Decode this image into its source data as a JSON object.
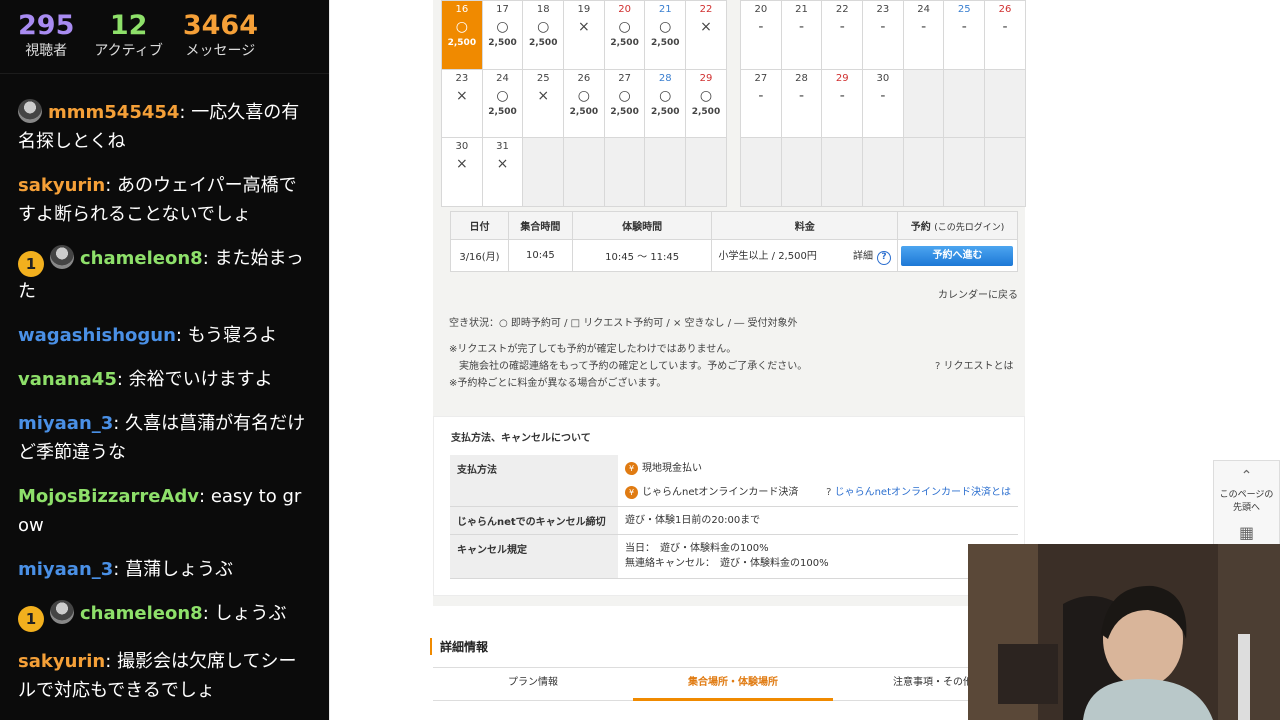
{
  "stats": [
    {
      "value": "295",
      "label": "視聴者",
      "color": "#a98cf2"
    },
    {
      "value": "12",
      "label": "アクティブ",
      "color": "#8ee06a"
    },
    {
      "value": "3464",
      "label": "メッセージ",
      "color": "#f5a038"
    }
  ],
  "chat": [
    {
      "badge": "",
      "avatar": true,
      "user": "mmm545454",
      "color": "#f5a038",
      "text": "一応久喜の有名探しとくね"
    },
    {
      "badge": "",
      "avatar": false,
      "user": "sakyurin",
      "color": "#f5a038",
      "text": "あのウェイパー高橋ですよ断られることないでしょ"
    },
    {
      "badge": "1",
      "avatar": true,
      "user": "chameleon8",
      "color": "#8ee06a",
      "text": "また始まった"
    },
    {
      "badge": "",
      "avatar": false,
      "user": "wagashishogun",
      "color": "#4a90e6",
      "text": "もう寝ろよ"
    },
    {
      "badge": "",
      "avatar": false,
      "user": "vanana45",
      "color": "#8ee06a",
      "text": "余裕でいけますよ"
    },
    {
      "badge": "",
      "avatar": false,
      "user": "miyaan_3",
      "color": "#4a90e6",
      "text": "久喜は菖蒲が有名だけど季節違うな"
    },
    {
      "badge": "",
      "avatar": false,
      "user": "MojosBizzarreAdv",
      "color": "#8ee06a",
      "text": "easy to grow"
    },
    {
      "badge": "",
      "avatar": false,
      "user": "miyaan_3",
      "color": "#4a90e6",
      "text": "菖蒲しょうぶ"
    },
    {
      "badge": "1",
      "avatar": true,
      "user": "chameleon8",
      "color": "#8ee06a",
      "text": "しょうぶ"
    },
    {
      "badge": "",
      "avatar": false,
      "user": "sakyurin",
      "color": "#f5a038",
      "text": "撮影会は欠席してシールで対応もできるでしょ"
    }
  ],
  "calendar_left": [
    [
      {
        "d": "16",
        "s": "○",
        "p": "2,500",
        "t": "selected"
      },
      {
        "d": "17",
        "s": "○",
        "p": "2,500"
      },
      {
        "d": "18",
        "s": "○",
        "p": "2,500"
      },
      {
        "d": "19",
        "s": "×",
        "p": ""
      },
      {
        "d": "20",
        "s": "○",
        "p": "2,500",
        "t": "sun"
      },
      {
        "d": "21",
        "s": "○",
        "p": "2,500",
        "t": "sat"
      },
      {
        "d": "22",
        "s": "×",
        "p": "",
        "t": "sun"
      }
    ],
    [
      {
        "d": "23",
        "s": "×",
        "p": ""
      },
      {
        "d": "24",
        "s": "○",
        "p": "2,500"
      },
      {
        "d": "25",
        "s": "×",
        "p": ""
      },
      {
        "d": "26",
        "s": "○",
        "p": "2,500"
      },
      {
        "d": "27",
        "s": "○",
        "p": "2,500"
      },
      {
        "d": "28",
        "s": "○",
        "p": "2,500",
        "t": "sat"
      },
      {
        "d": "29",
        "s": "○",
        "p": "2,500",
        "t": "sun"
      }
    ],
    [
      {
        "d": "30",
        "s": "×",
        "p": ""
      },
      {
        "d": "31",
        "s": "×",
        "p": ""
      },
      {
        "d": "",
        "s": "",
        "p": "",
        "t": "empty"
      },
      {
        "d": "",
        "s": "",
        "p": "",
        "t": "empty"
      },
      {
        "d": "",
        "s": "",
        "p": "",
        "t": "empty"
      },
      {
        "d": "",
        "s": "",
        "p": "",
        "t": "empty"
      },
      {
        "d": "",
        "s": "",
        "p": "",
        "t": "empty"
      }
    ]
  ],
  "calendar_right": [
    [
      {
        "d": "20",
        "s": "-"
      },
      {
        "d": "21",
        "s": "-"
      },
      {
        "d": "22",
        "s": "-"
      },
      {
        "d": "23",
        "s": "-"
      },
      {
        "d": "24",
        "s": "-"
      },
      {
        "d": "25",
        "s": "-",
        "t": "sat"
      },
      {
        "d": "26",
        "s": "-",
        "t": "sun"
      }
    ],
    [
      {
        "d": "27",
        "s": "-"
      },
      {
        "d": "28",
        "s": "-"
      },
      {
        "d": "29",
        "s": "-",
        "t": "sun"
      },
      {
        "d": "30",
        "s": "-"
      },
      {
        "d": "",
        "s": "",
        "t": "empty"
      },
      {
        "d": "",
        "s": "",
        "t": "empty"
      },
      {
        "d": "",
        "s": "",
        "t": "empty"
      }
    ],
    [
      {
        "d": "",
        "s": "",
        "t": "empty"
      },
      {
        "d": "",
        "s": "",
        "t": "empty"
      },
      {
        "d": "",
        "s": "",
        "t": "empty"
      },
      {
        "d": "",
        "s": "",
        "t": "empty"
      },
      {
        "d": "",
        "s": "",
        "t": "empty"
      },
      {
        "d": "",
        "s": "",
        "t": "empty"
      },
      {
        "d": "",
        "s": "",
        "t": "empty"
      }
    ]
  ],
  "plan_table": {
    "headers": [
      "日付",
      "集合時間",
      "体験時間",
      "料金",
      "予約"
    ],
    "reserve_note": "(この先ログイン)",
    "row": {
      "date": "3/16(月)",
      "meet": "10:45",
      "time": "10:45 ～ 11:45",
      "price": "小学生以上 / 2,500円",
      "detail": "詳細",
      "button": "予約へ進む"
    }
  },
  "back_to_calendar": "カレンダーに戻る",
  "legend": "空き状況：○ 即時予約可 / □ リクエスト予約可 / × 空きなし / ― 受付対象外",
  "notes": [
    "※リクエストが完了しても予約が確定したわけではありません。",
    "　実施会社の確認連絡をもって予約の確定としています。予めご了承ください。",
    "※予約枠ごとに料金が異なる場合がございます。"
  ],
  "request_link": "リクエストとは",
  "payment": {
    "title": "支払方法、キャンセルについて",
    "method_label": "支払方法",
    "methods": [
      "現地現金払い",
      "じゃらんnetオンラインカード決済"
    ],
    "card_link": "じゃらんnetオンラインカード決済とは",
    "cancel_deadline_label": "じゃらんnetでのキャンセル締切",
    "cancel_deadline": "遊び・体験1日前の20:00まで",
    "cancel_policy_label": "キャンセル規定",
    "cancel_policy": [
      "当日：　遊び・体験料金の100%",
      "無連絡キャンセル：　遊び・体験料金の100%"
    ]
  },
  "detail_heading": "詳細情報",
  "tabs": [
    "プラン情報",
    "集合場所・体験場所",
    "注意事項・その他"
  ],
  "back_to_top": {
    "line1": "このページの",
    "line2": "先頭へ"
  }
}
